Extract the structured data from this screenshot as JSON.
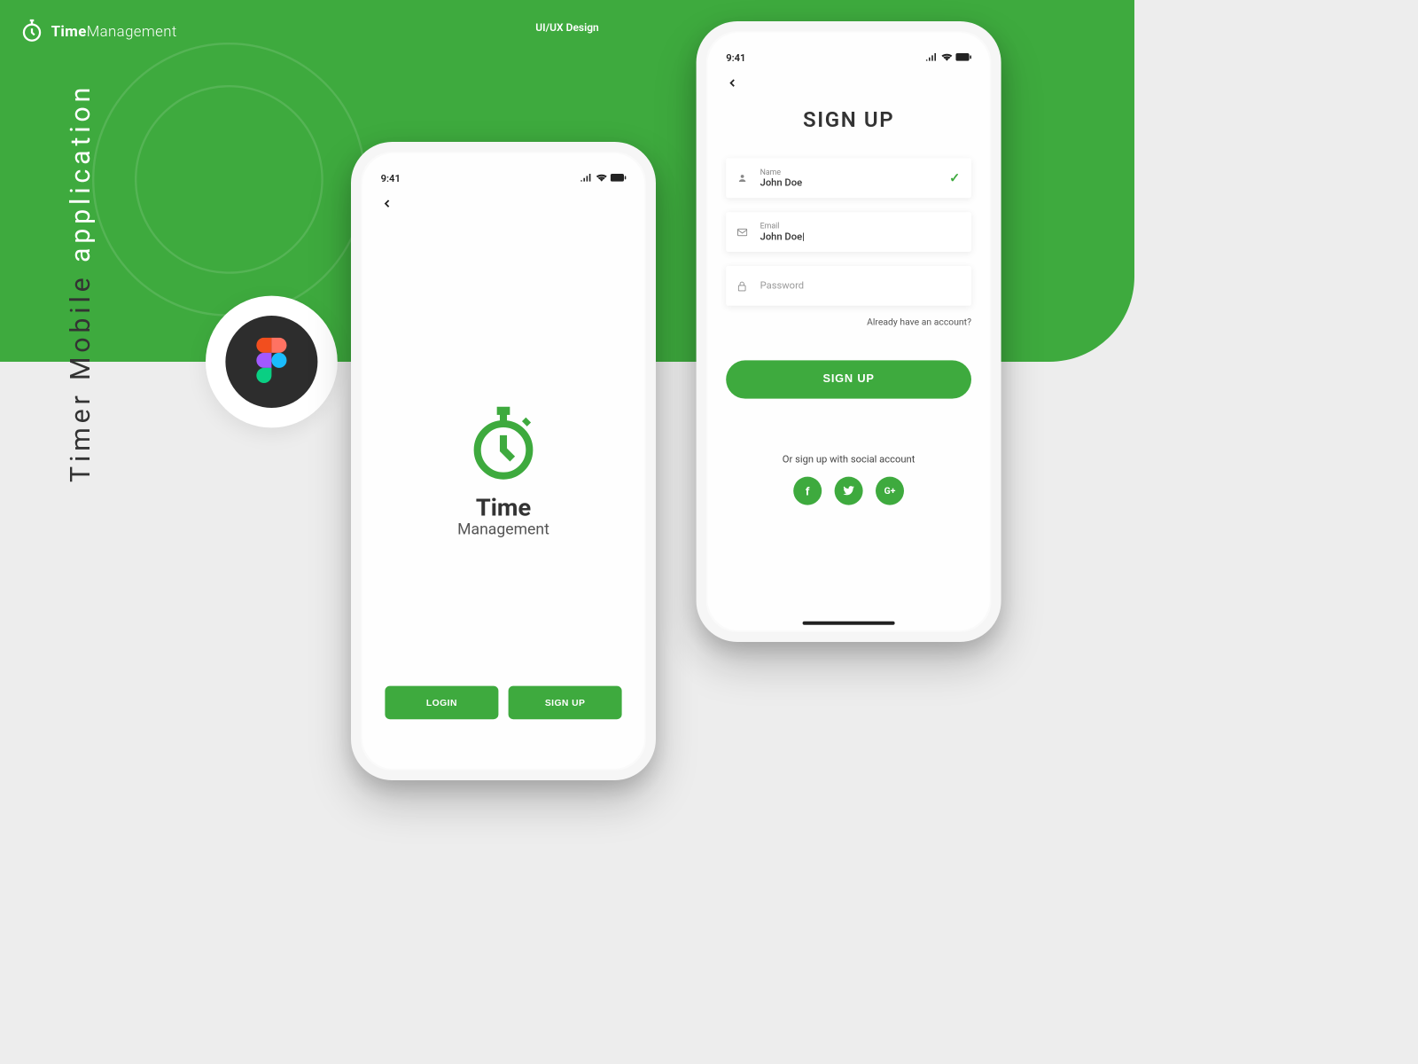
{
  "brand": {
    "bold": "Time",
    "light": "Management"
  },
  "header": {
    "subtitle": "UI/UX Design"
  },
  "sideText": {
    "line1": "Timer Mobile",
    "line2": "application"
  },
  "statusTime": "9:41",
  "phone1": {
    "title": "Time",
    "subtitle": "Management",
    "loginBtn": "LOGIN",
    "signupBtn": "SIGN UP"
  },
  "phone2": {
    "title": "SIGN UP",
    "nameLabel": "Name",
    "nameValue": "John Doe",
    "emailLabel": "Email",
    "emailValue": "John Doe|",
    "passwordPlaceholder": "Password",
    "already": "Already have an account?",
    "signupBtn": "SIGN UP",
    "socialText": "Or sign up with social account",
    "fb": "f",
    "gplus": "G+"
  }
}
